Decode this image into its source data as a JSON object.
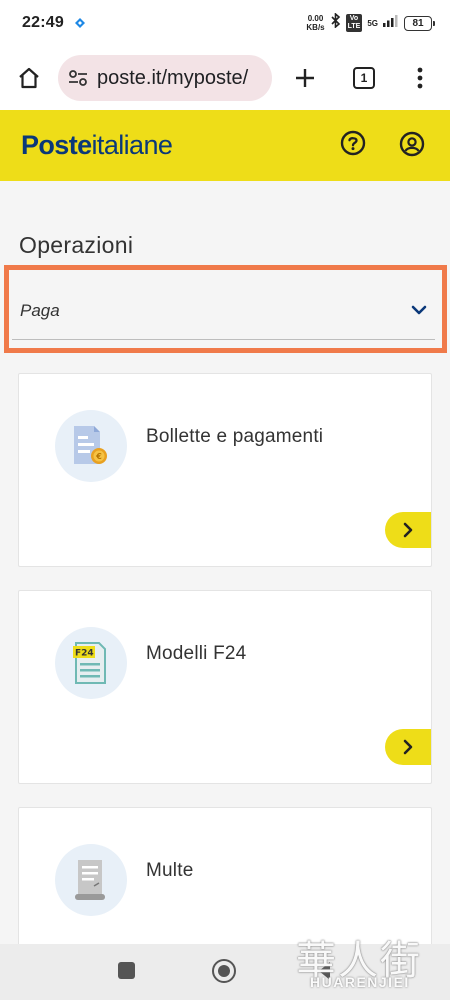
{
  "status_bar": {
    "time": "22:49",
    "net_speed_value": "0.00",
    "net_speed_unit": "KB/s",
    "volte_top": "Vo",
    "volte_bottom": "LTE",
    "signal_label": "5G",
    "battery": "81"
  },
  "browser": {
    "url": "poste.it/myposte/",
    "tab_count": "1"
  },
  "site": {
    "logo_bold": "Poste",
    "logo_light": "italiane",
    "brand_yellow": "#eedd18",
    "brand_blue": "#0a3879"
  },
  "main": {
    "section_title": "Operazioni",
    "dropdown": {
      "selected": "Paga",
      "highlight_color": "#f07a4a"
    },
    "cards": [
      {
        "label": "Bollette e pagamenti",
        "icon": "bill-payment-icon"
      },
      {
        "label": "Modelli F24",
        "icon": "f24-form-icon",
        "icon_text": "F24"
      },
      {
        "label": "Multe",
        "icon": "fine-receipt-icon"
      }
    ]
  },
  "watermark": {
    "han": "華人街",
    "latin": "HUARENJIEI"
  }
}
